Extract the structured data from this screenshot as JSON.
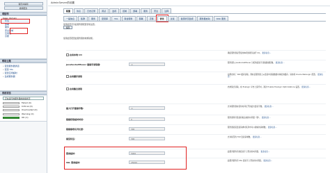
{
  "sidebar": {
    "buttons": [
      "锁定并编辑",
      "撤销更改"
    ],
    "domain_heading": "域结构",
    "tree": [
      {
        "label": "base_domain",
        "level": 0
      },
      {
        "label": "环境",
        "level": 1,
        "selected": true
      },
      {
        "label": "部署",
        "level": 1
      },
      {
        "label": "服务",
        "level": 1
      },
      {
        "label": "安全领域",
        "level": 1
      },
      {
        "label": "互用性",
        "level": 1
      },
      {
        "label": "诊断",
        "level": 1
      }
    ],
    "howto_heading": "帮助主题",
    "howto_links": [
      "配置服务器通道",
      "配置 SSL",
      "配置空闲超时",
      "监视服务器"
    ],
    "health_heading": "系统状态",
    "health_select": "正在运行的服务器的健康状况",
    "health_items": [
      {
        "label": "Failed (0)",
        "ok": false
      },
      {
        "label": "Critical (0)",
        "ok": false
      },
      {
        "label": "Overloaded (0)",
        "ok": false
      },
      {
        "label": "Warning (0)",
        "ok": false
      },
      {
        "label": "OK (1)",
        "ok": true
      }
    ]
  },
  "main": {
    "title": "AdminServer的设置",
    "tabs_row1": [
      "配置",
      "协议",
      "日志记录",
      "调试",
      "监视",
      "控制",
      "部署",
      "服务",
      "安全",
      "注释"
    ],
    "tabs_row2": [
      "一般信息",
      "集群",
      "服务",
      "密钥库",
      "SSL",
      "联合服务",
      "部署",
      "迁移",
      "优化",
      "过载",
      "健康状况监视",
      "服务器启动",
      "Web 服务"
    ],
    "active_tab_row2": "优化",
    "save_label": "保存",
    "intro_text": "使用此页可为此服务器配置优化设置。",
    "intro_text2": "使用此页配置此服务器的常规功能。",
    "more_info": "更多信息...",
    "rows": [
      {
        "label": "启用本地 I/O",
        "checkbox": true,
        "value": "",
        "desc": "确定服务器是否使用本机性能包进行 I/O。"
      },
      {
        "label": "JavaSocketMuxer 套接字读取器:",
        "checkbox": false,
        "value": "-1",
        "desc": "服务器为 JavaSocketMuxer 分配的套接字读取器线程数。"
      },
      {
        "label": "启用缓存读取",
        "checkbox": true,
        "value": "",
        "desc": "如果启用了 NIO 缓存读取，则在该服务器上从连接中读取数据时将使用缓存。请参阅 Oracle WebLogic 配置。"
      },
      {
        "label": "启用集合读取",
        "checkbox": true,
        "value": "",
        "desc": "启用集合读取。在 Exalogic 平台上运行时，通过 Enable Exalogic Optimizations 设置。"
      },
      {
        "label": "最大打开套接字数:",
        "checkbox": false,
        "value": "-1",
        "desc": "允许服务器在任何时间打开的最大套接字数。"
      },
      {
        "label": "链接获取超时时间:",
        "checkbox": false,
        "value": "0",
        "desc": "服务器等待链接获取完成的时间量（秒）。"
      },
      {
        "label": "链接接收队列长度:",
        "checkbox": false,
        "value": "300",
        "desc": "服务器接受连接请求时队列中可以容纳的请求数。"
      },
      {
        "label": "接受积压:",
        "checkbox": false,
        "value": "300",
        "desc": "允许积压的 TCP 连接请求数。"
      },
      {
        "label": "登录超时:",
        "checkbox": false,
        "value": "5000",
        "desc": "此服务器等待新套接字上登录的时间量。"
      },
      {
        "label": "SSL 登录超时:",
        "checkbox": false,
        "value": "25000",
        "desc": "此服务器等待 SSL 套接字上登录的时间量。"
      }
    ]
  }
}
